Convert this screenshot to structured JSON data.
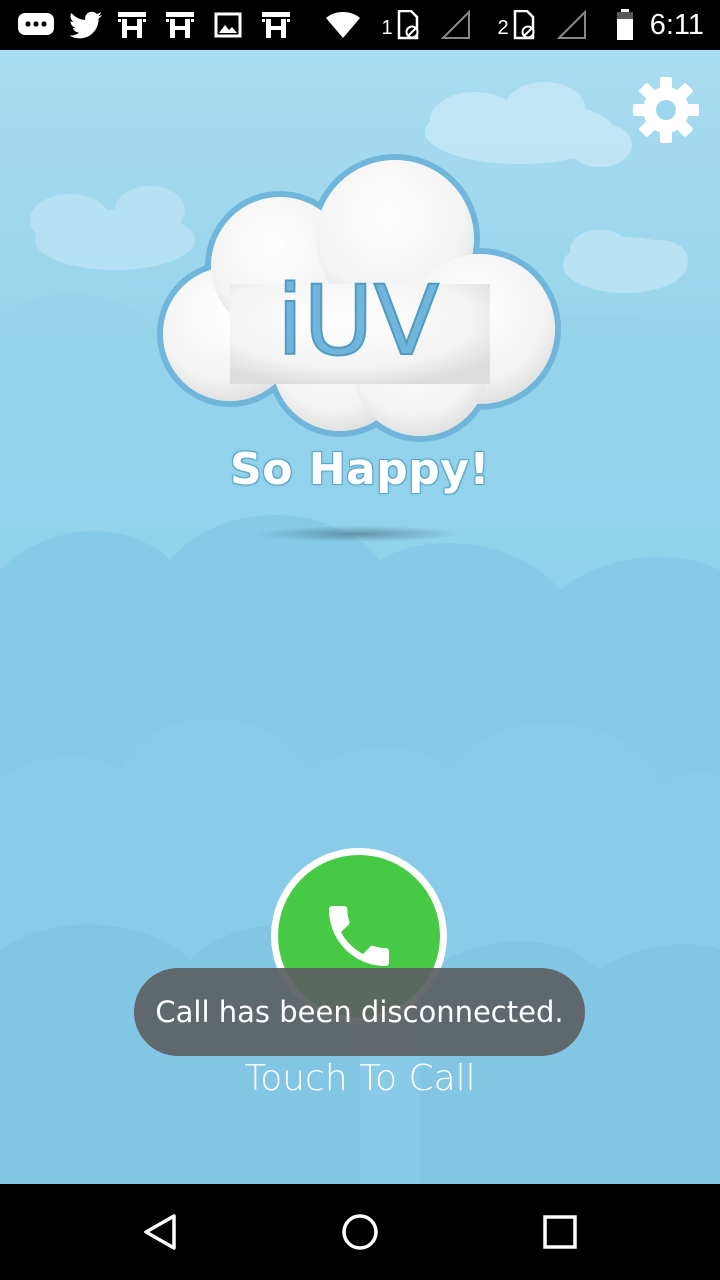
{
  "status_bar": {
    "time": "6:11",
    "sim1_label": "1",
    "sim2_label": "2",
    "icons": [
      "messaging-icon",
      "twitter-icon",
      "app-h-icon",
      "app-h-icon",
      "image-icon",
      "app-h-icon",
      "wifi-icon",
      "sim-1-icon",
      "signal-1-icon",
      "sim-2-icon",
      "signal-2-icon",
      "battery-icon"
    ]
  },
  "app": {
    "logo_text": "iUV",
    "tagline": "So Happy!",
    "call_label": "Touch To Call",
    "settings_icon": "gear-icon",
    "call_icon": "phone-icon"
  },
  "toast": {
    "message": "Call has been disconnected."
  },
  "nav_bar": {
    "icons": [
      "back-icon",
      "home-icon",
      "recents-icon"
    ]
  },
  "colors": {
    "sky": "#8ecfea",
    "call_green": "#46c944",
    "logo_blue": "#6fb6da",
    "toast_bg": "#5c6063"
  }
}
